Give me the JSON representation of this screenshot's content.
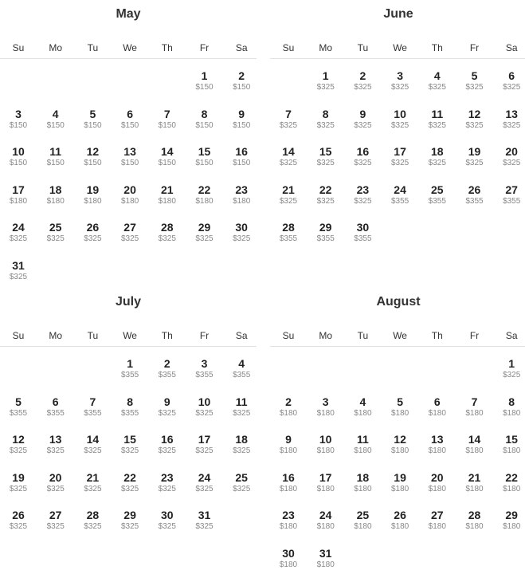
{
  "weekdays": [
    "Su",
    "Mo",
    "Tu",
    "We",
    "Th",
    "Fr",
    "Sa"
  ],
  "months": [
    {
      "name": "May",
      "first_weekday": 5,
      "days": [
        {
          "n": "1",
          "p": "$150"
        },
        {
          "n": "2",
          "p": "$150"
        },
        {
          "n": "3",
          "p": "$150"
        },
        {
          "n": "4",
          "p": "$150"
        },
        {
          "n": "5",
          "p": "$150"
        },
        {
          "n": "6",
          "p": "$150"
        },
        {
          "n": "7",
          "p": "$150"
        },
        {
          "n": "8",
          "p": "$150"
        },
        {
          "n": "9",
          "p": "$150"
        },
        {
          "n": "10",
          "p": "$150"
        },
        {
          "n": "11",
          "p": "$150"
        },
        {
          "n": "12",
          "p": "$150"
        },
        {
          "n": "13",
          "p": "$150"
        },
        {
          "n": "14",
          "p": "$150"
        },
        {
          "n": "15",
          "p": "$150"
        },
        {
          "n": "16",
          "p": "$150"
        },
        {
          "n": "17",
          "p": "$180"
        },
        {
          "n": "18",
          "p": "$180"
        },
        {
          "n": "19",
          "p": "$180"
        },
        {
          "n": "20",
          "p": "$180"
        },
        {
          "n": "21",
          "p": "$180"
        },
        {
          "n": "22",
          "p": "$180"
        },
        {
          "n": "23",
          "p": "$180"
        },
        {
          "n": "24",
          "p": "$325"
        },
        {
          "n": "25",
          "p": "$325"
        },
        {
          "n": "26",
          "p": "$325"
        },
        {
          "n": "27",
          "p": "$325"
        },
        {
          "n": "28",
          "p": "$325"
        },
        {
          "n": "29",
          "p": "$325"
        },
        {
          "n": "30",
          "p": "$325"
        },
        {
          "n": "31",
          "p": "$325"
        }
      ]
    },
    {
      "name": "June",
      "first_weekday": 1,
      "days": [
        {
          "n": "1",
          "p": "$325"
        },
        {
          "n": "2",
          "p": "$325"
        },
        {
          "n": "3",
          "p": "$325"
        },
        {
          "n": "4",
          "p": "$325"
        },
        {
          "n": "5",
          "p": "$325"
        },
        {
          "n": "6",
          "p": "$325"
        },
        {
          "n": "7",
          "p": "$325"
        },
        {
          "n": "8",
          "p": "$325"
        },
        {
          "n": "9",
          "p": "$325"
        },
        {
          "n": "10",
          "p": "$325"
        },
        {
          "n": "11",
          "p": "$325"
        },
        {
          "n": "12",
          "p": "$325"
        },
        {
          "n": "13",
          "p": "$325"
        },
        {
          "n": "14",
          "p": "$325"
        },
        {
          "n": "15",
          "p": "$325"
        },
        {
          "n": "16",
          "p": "$325"
        },
        {
          "n": "17",
          "p": "$325"
        },
        {
          "n": "18",
          "p": "$325"
        },
        {
          "n": "19",
          "p": "$325"
        },
        {
          "n": "20",
          "p": "$325"
        },
        {
          "n": "21",
          "p": "$325"
        },
        {
          "n": "22",
          "p": "$325"
        },
        {
          "n": "23",
          "p": "$325"
        },
        {
          "n": "24",
          "p": "$355"
        },
        {
          "n": "25",
          "p": "$355"
        },
        {
          "n": "26",
          "p": "$355"
        },
        {
          "n": "27",
          "p": "$355"
        },
        {
          "n": "28",
          "p": "$355"
        },
        {
          "n": "29",
          "p": "$355"
        },
        {
          "n": "30",
          "p": "$355"
        }
      ]
    },
    {
      "name": "July",
      "first_weekday": 3,
      "days": [
        {
          "n": "1",
          "p": "$355"
        },
        {
          "n": "2",
          "p": "$355"
        },
        {
          "n": "3",
          "p": "$355"
        },
        {
          "n": "4",
          "p": "$355"
        },
        {
          "n": "5",
          "p": "$355"
        },
        {
          "n": "6",
          "p": "$355"
        },
        {
          "n": "7",
          "p": "$355"
        },
        {
          "n": "8",
          "p": "$355"
        },
        {
          "n": "9",
          "p": "$325"
        },
        {
          "n": "10",
          "p": "$325"
        },
        {
          "n": "11",
          "p": "$325"
        },
        {
          "n": "12",
          "p": "$325"
        },
        {
          "n": "13",
          "p": "$325"
        },
        {
          "n": "14",
          "p": "$325"
        },
        {
          "n": "15",
          "p": "$325"
        },
        {
          "n": "16",
          "p": "$325"
        },
        {
          "n": "17",
          "p": "$325"
        },
        {
          "n": "18",
          "p": "$325"
        },
        {
          "n": "19",
          "p": "$325"
        },
        {
          "n": "20",
          "p": "$325"
        },
        {
          "n": "21",
          "p": "$325"
        },
        {
          "n": "22",
          "p": "$325"
        },
        {
          "n": "23",
          "p": "$325"
        },
        {
          "n": "24",
          "p": "$325"
        },
        {
          "n": "25",
          "p": "$325"
        },
        {
          "n": "26",
          "p": "$325"
        },
        {
          "n": "27",
          "p": "$325"
        },
        {
          "n": "28",
          "p": "$325"
        },
        {
          "n": "29",
          "p": "$325"
        },
        {
          "n": "30",
          "p": "$325"
        },
        {
          "n": "31",
          "p": "$325"
        }
      ]
    },
    {
      "name": "August",
      "first_weekday": 6,
      "days": [
        {
          "n": "1",
          "p": "$325"
        },
        {
          "n": "2",
          "p": "$180"
        },
        {
          "n": "3",
          "p": "$180"
        },
        {
          "n": "4",
          "p": "$180"
        },
        {
          "n": "5",
          "p": "$180"
        },
        {
          "n": "6",
          "p": "$180"
        },
        {
          "n": "7",
          "p": "$180"
        },
        {
          "n": "8",
          "p": "$180"
        },
        {
          "n": "9",
          "p": "$180"
        },
        {
          "n": "10",
          "p": "$180"
        },
        {
          "n": "11",
          "p": "$180"
        },
        {
          "n": "12",
          "p": "$180"
        },
        {
          "n": "13",
          "p": "$180"
        },
        {
          "n": "14",
          "p": "$180"
        },
        {
          "n": "15",
          "p": "$180"
        },
        {
          "n": "16",
          "p": "$180"
        },
        {
          "n": "17",
          "p": "$180"
        },
        {
          "n": "18",
          "p": "$180"
        },
        {
          "n": "19",
          "p": "$180"
        },
        {
          "n": "20",
          "p": "$180"
        },
        {
          "n": "21",
          "p": "$180"
        },
        {
          "n": "22",
          "p": "$180"
        },
        {
          "n": "23",
          "p": "$180"
        },
        {
          "n": "24",
          "p": "$180"
        },
        {
          "n": "25",
          "p": "$180"
        },
        {
          "n": "26",
          "p": "$180"
        },
        {
          "n": "27",
          "p": "$180"
        },
        {
          "n": "28",
          "p": "$180"
        },
        {
          "n": "29",
          "p": "$180"
        },
        {
          "n": "30",
          "p": "$180"
        },
        {
          "n": "31",
          "p": "$180"
        }
      ]
    }
  ]
}
